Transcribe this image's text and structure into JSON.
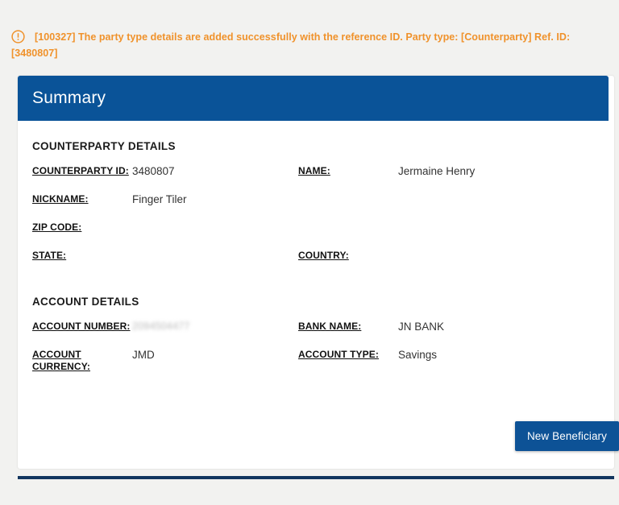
{
  "alert": {
    "icon": "exclamation-circle-icon",
    "color": "#f0922b",
    "message": "[100327] The party type details are added successfully with the reference ID. Party type: [Counterparty] Ref. ID: [3480807]"
  },
  "card": {
    "title": "Summary",
    "header_color": "#0a5398",
    "sections": [
      {
        "title": "COUNTERPARTY DETAILS",
        "rows": [
          {
            "left_label": "COUNTERPARTY ID:",
            "left_value": "3480807",
            "right_label": "NAME:",
            "right_value": "Jermaine Henry"
          },
          {
            "left_label": "NICKNAME:",
            "left_value": "Finger Tiler",
            "right_label": "",
            "right_value": ""
          },
          {
            "left_label": "ZIP CODE:",
            "left_value": "",
            "right_label": "",
            "right_value": ""
          },
          {
            "left_label": "STATE:",
            "left_value": "",
            "right_label": "COUNTRY:",
            "right_value": ""
          }
        ]
      },
      {
        "title": "ACCOUNT DETAILS",
        "rows": [
          {
            "left_label": "ACCOUNT NUMBER:",
            "left_value": "2094504477",
            "right_label": "BANK NAME:",
            "right_value": "JN BANK"
          },
          {
            "left_label": "ACCOUNT CURRENCY:",
            "left_value": "JMD",
            "right_label": "ACCOUNT TYPE:",
            "right_value": "Savings"
          }
        ]
      }
    ],
    "new_beneficiary_label": "New Beneficiary",
    "button_color": "#0d5296"
  }
}
